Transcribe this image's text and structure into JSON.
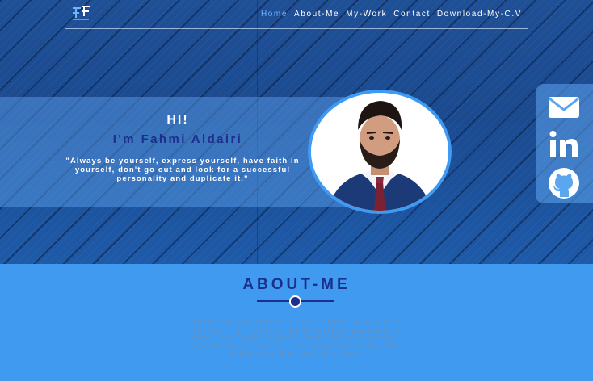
{
  "nav": {
    "logo_icon": "ff-monogram-logo-icon",
    "items": [
      {
        "label": "Home",
        "active": true
      },
      {
        "label": "About-Me",
        "active": false
      },
      {
        "label": "My-Work",
        "active": false
      },
      {
        "label": "Contact",
        "active": false
      },
      {
        "label": "Download-My-C.V",
        "active": false
      }
    ]
  },
  "hero": {
    "greeting": "HI!",
    "name": "I'm Fahmi Aldairi",
    "quote": "\"Always be yourself, express yourself, have faith in yourself, don't go out and look for a successful personality and duplicate it.\""
  },
  "social": {
    "icons": [
      "mail-icon",
      "linkedin-icon",
      "github-icon"
    ]
  },
  "about": {
    "title": "ABOUT-ME",
    "text": "I followed my passion as part of the developer's society. I am reliable, hard-working, attentive to detail, and eager to learn about new technologies and business issues. I can work well on my own initiative and as part of a team."
  },
  "colors": {
    "accent_dark": "#1b2f8c",
    "accent_light": "#3f9af0",
    "nav_active": "#6fb2ff"
  }
}
